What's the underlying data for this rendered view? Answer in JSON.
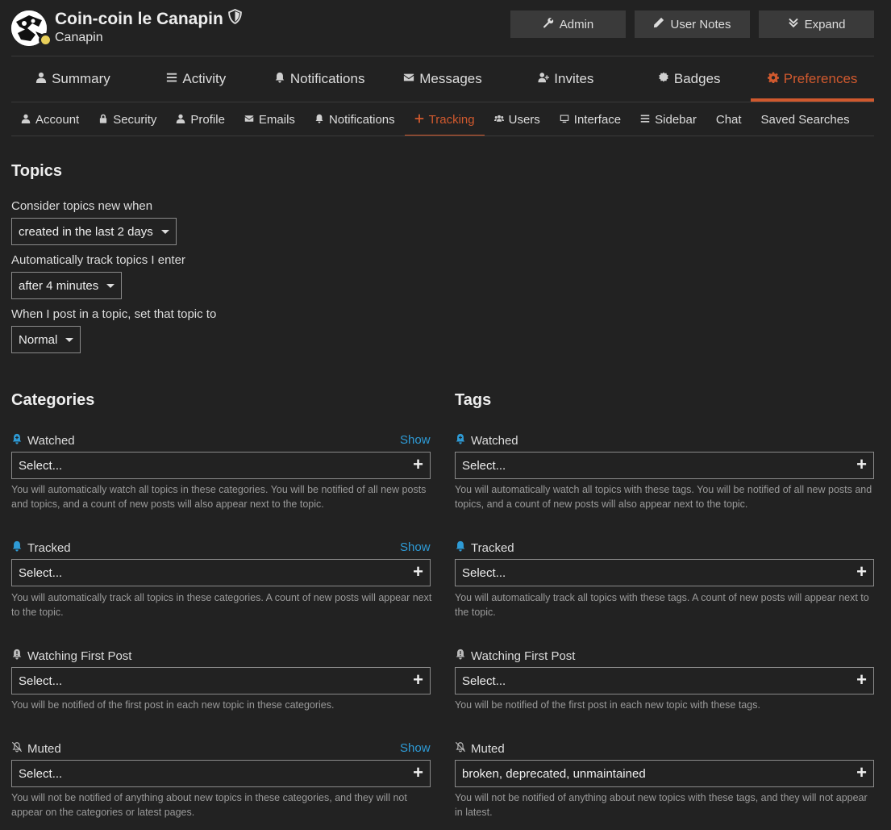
{
  "user": {
    "name": "Coin-coin le Canapin",
    "handle": "Canapin"
  },
  "header_buttons": [
    {
      "label": "Admin",
      "icon": "wrench-icon"
    },
    {
      "label": "User Notes",
      "icon": "pencil-icon"
    },
    {
      "label": "Expand",
      "icon": "angles-down-icon"
    }
  ],
  "main_nav": [
    {
      "label": "Summary",
      "icon": "user-icon",
      "active": false
    },
    {
      "label": "Activity",
      "icon": "bars-icon",
      "active": false
    },
    {
      "label": "Notifications",
      "icon": "bell-icon",
      "active": false
    },
    {
      "label": "Messages",
      "icon": "envelope-icon",
      "active": false
    },
    {
      "label": "Invites",
      "icon": "user-plus-icon",
      "active": false
    },
    {
      "label": "Badges",
      "icon": "certificate-icon",
      "active": false
    },
    {
      "label": "Preferences",
      "icon": "gear-icon",
      "active": true
    }
  ],
  "sub_nav": [
    {
      "label": "Account",
      "icon": "user-icon",
      "active": false
    },
    {
      "label": "Security",
      "icon": "lock-icon",
      "active": false
    },
    {
      "label": "Profile",
      "icon": "user-icon",
      "active": false
    },
    {
      "label": "Emails",
      "icon": "envelope-icon",
      "active": false
    },
    {
      "label": "Notifications",
      "icon": "bell-icon",
      "active": false
    },
    {
      "label": "Tracking",
      "icon": "plus-icon",
      "active": true
    },
    {
      "label": "Users",
      "icon": "users-icon",
      "active": false
    },
    {
      "label": "Interface",
      "icon": "desktop-icon",
      "active": false
    },
    {
      "label": "Sidebar",
      "icon": "bars-icon",
      "active": false
    },
    {
      "label": "Chat",
      "icon": "",
      "active": false
    },
    {
      "label": "Saved Searches",
      "icon": "",
      "active": false
    }
  ],
  "topics": {
    "heading": "Topics",
    "new_label": "Consider topics new when",
    "new_value": "created in the last 2 days",
    "track_label": "Automatically track topics I enter",
    "track_value": "after 4 minutes",
    "post_label": "When I post in a topic, set that topic to",
    "post_value": "Normal"
  },
  "categories": {
    "heading": "Categories",
    "watched": {
      "label": "Watched",
      "show": "Show",
      "value": "Select...",
      "desc": "You will automatically watch all topics in these categories. You will be notified of all new posts and topics, and a count of new posts will also appear next to the topic."
    },
    "tracked": {
      "label": "Tracked",
      "show": "Show",
      "value": "Select...",
      "desc": "You will automatically track all topics in these categories. A count of new posts will appear next to the topic."
    },
    "first_post": {
      "label": "Watching First Post",
      "value": "Select...",
      "desc": "You will be notified of the first post in each new topic in these categories."
    },
    "muted": {
      "label": "Muted",
      "show": "Show",
      "value": "Select...",
      "desc": "You will not be notified of anything about new topics in these categories, and they will not appear on the categories or latest pages."
    }
  },
  "tags": {
    "heading": "Tags",
    "watched": {
      "label": "Watched",
      "value": "Select...",
      "desc": "You will automatically watch all topics with these tags. You will be notified of all new posts and topics, and a count of new posts will also appear next to the topic."
    },
    "tracked": {
      "label": "Tracked",
      "value": "Select...",
      "desc": "You will automatically track all topics with these tags. A count of new posts will appear next to the topic."
    },
    "first_post": {
      "label": "Watching First Post",
      "value": "Select...",
      "desc": "You will be notified of the first post in each new topic with these tags."
    },
    "muted": {
      "label": "Muted",
      "value": "broken, deprecated, unmaintained",
      "desc": "You will not be notified of anything about new topics with these tags, and they will not appear in latest."
    }
  },
  "colors": {
    "background": "#222222",
    "accent": "#d0592e",
    "link": "#2e9bd6",
    "bell_watched": "#2e9bd6"
  }
}
